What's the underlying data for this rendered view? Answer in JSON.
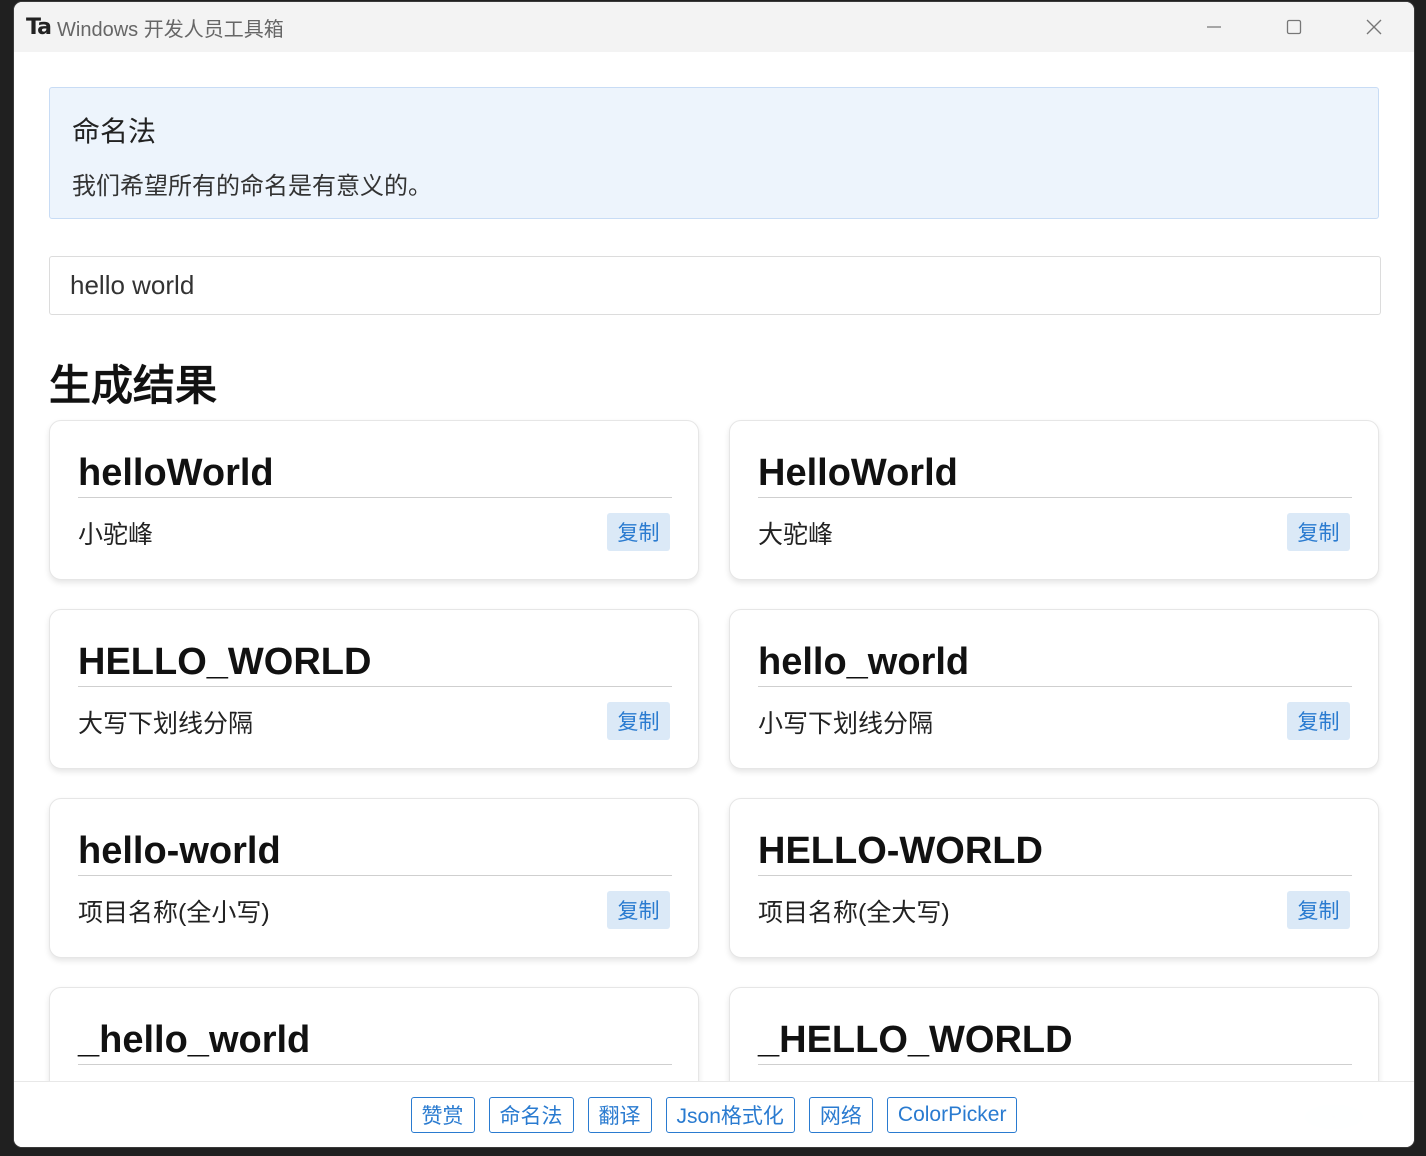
{
  "window": {
    "logo": "Ta",
    "title": "Windows 开发人员工具箱"
  },
  "info": {
    "title": "命名法",
    "description": "我们希望所有的命名是有意义的。"
  },
  "input": {
    "value": "hello world"
  },
  "results": {
    "title": "生成结果",
    "copy_label": "复制",
    "items": [
      {
        "name": "helloWorld",
        "desc": "小驼峰"
      },
      {
        "name": "HelloWorld",
        "desc": "大驼峰"
      },
      {
        "name": "HELLO_WORLD",
        "desc": "大写下划线分隔"
      },
      {
        "name": "hello_world",
        "desc": "小写下划线分隔"
      },
      {
        "name": "hello-world",
        "desc": "项目名称(全小写)"
      },
      {
        "name": "HELLO-WORLD",
        "desc": "项目名称(全大写)"
      },
      {
        "name": "_hello_world",
        "desc": ""
      },
      {
        "name": "_HELLO_WORLD",
        "desc": ""
      }
    ]
  },
  "nav": [
    "赞赏",
    "命名法",
    "翻译",
    "Json格式化",
    "网络",
    "ColorPicker"
  ],
  "colors": {
    "accent": "#2a7bd0",
    "info_bg": "#edf4fc",
    "copy_bg": "#dbe9f7"
  }
}
